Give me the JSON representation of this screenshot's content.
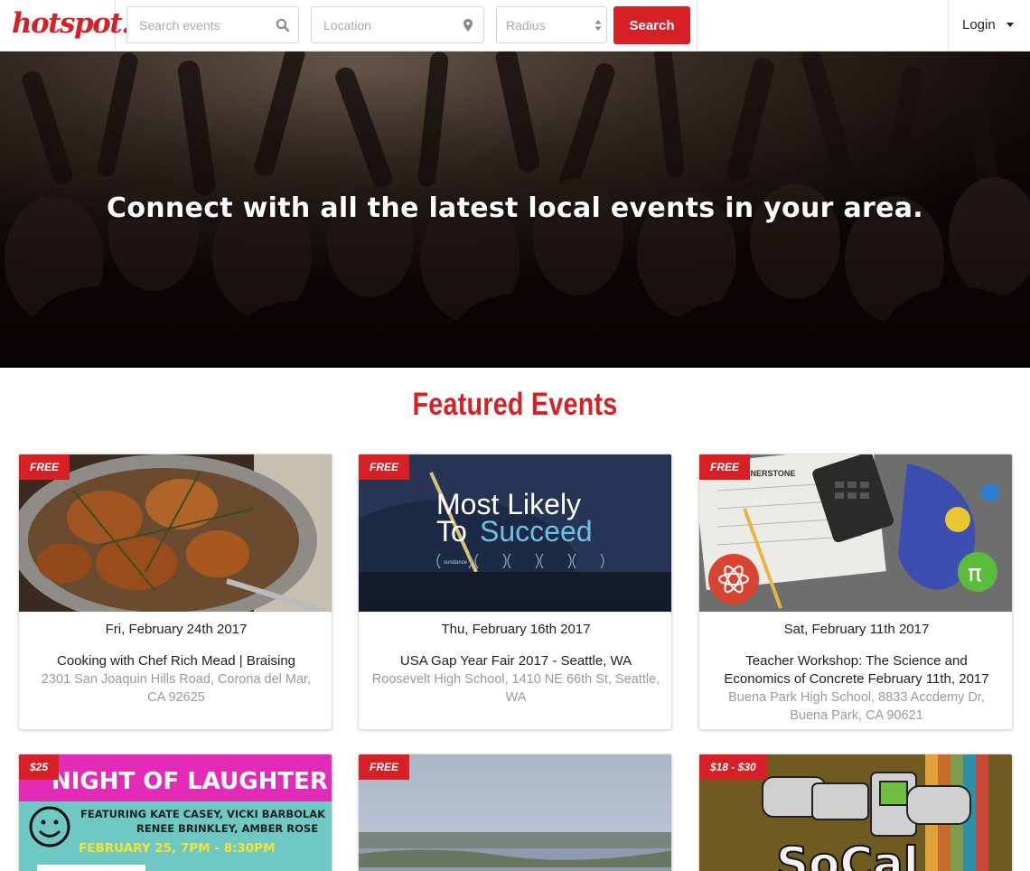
{
  "brand": {
    "name": "hotspot."
  },
  "header": {
    "search_placeholder": "Search events",
    "location_placeholder": "Location",
    "radius_value": "Radius",
    "search_label": "Search",
    "login_label": "Login",
    "search_icon": "magnifier-icon",
    "location_icon": "map-pin-icon",
    "radius_icon": "up-down-arrows-icon",
    "login_icon": "caret-down-icon"
  },
  "hero": {
    "headline": "Connect with all the latest local events in your area."
  },
  "featured": {
    "heading": "Featured Events",
    "events": [
      {
        "badge": "FREE",
        "date": "Fri, February 24th 2017",
        "title": "Cooking with Chef Rich Mead | Braising",
        "address": "2301 San Joaquin Hills Road, Corona del Mar, CA 92625"
      },
      {
        "badge": "FREE",
        "date": "Thu, February 16th 2017",
        "title": "USA Gap Year Fair 2017 - Seattle, WA",
        "address": "Roosevelt High School, 1410 NE 66th St, Seattle, WA",
        "image_text": {
          "line1": "Most Likely",
          "line2_a": "To",
          "line2_b": "Succeed",
          "festival": "sundance"
        }
      },
      {
        "badge": "FREE",
        "date": "Sat, February 11th 2017",
        "title": "Teacher Workshop: The Science and Economics of Concrete February 11th, 2017",
        "address": "Buena Park High School, 8833 Accdemy Dr, Buena Park, CA 90621",
        "image_text": {
          "sheet": "CT CORNERSTONE",
          "pi": "π"
        }
      },
      {
        "badge": "$25",
        "image_text": {
          "title": "NIGHT OF LAUGHTER",
          "featuring_1": "FEATURING KATE CASEY, VICKI BARBOLAK",
          "featuring_2": "RENEE BRINKLEY, AMBER ROSE",
          "when": "FEBRUARY 25, 7PM - 8:30PM"
        }
      },
      {
        "badge": "FREE"
      },
      {
        "badge": "$18 - $30",
        "image_text": {
          "logo": "SoCal"
        }
      }
    ]
  }
}
